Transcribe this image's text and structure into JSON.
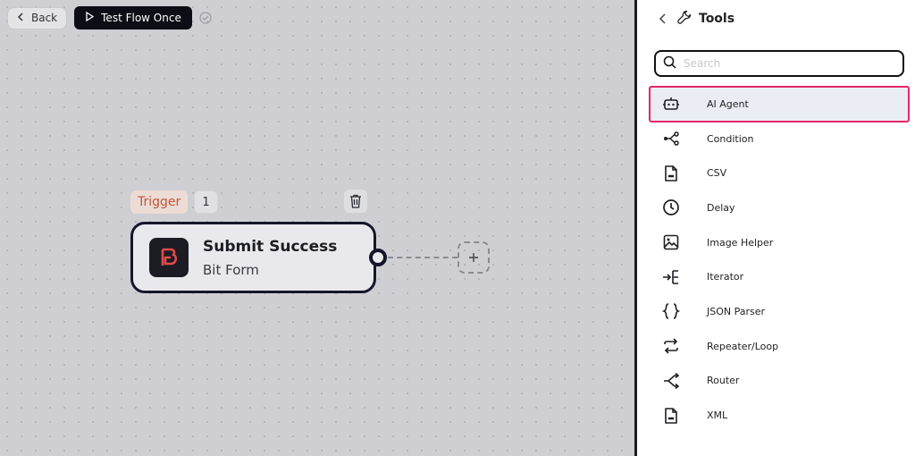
{
  "toolbar": {
    "back_label": "Back",
    "test_label": "Test Flow Once"
  },
  "flow": {
    "trigger_label": "Trigger",
    "node_count": "1",
    "node": {
      "title": "Submit Success",
      "subtitle": "Bit Form"
    }
  },
  "panel": {
    "title": "Tools",
    "search_placeholder": "Search",
    "items": [
      {
        "label": "AI Agent",
        "icon": "robot-icon",
        "active": true
      },
      {
        "label": "Condition",
        "icon": "condition-icon"
      },
      {
        "label": "CSV",
        "icon": "csv-file-icon"
      },
      {
        "label": "Delay",
        "icon": "clock-icon"
      },
      {
        "label": "Image Helper",
        "icon": "image-icon"
      },
      {
        "label": "Iterator",
        "icon": "iterator-icon"
      },
      {
        "label": "JSON Parser",
        "icon": "braces-icon"
      },
      {
        "label": "Repeater/Loop",
        "icon": "repeat-icon"
      },
      {
        "label": "Router",
        "icon": "router-icon"
      },
      {
        "label": "XML",
        "icon": "xml-file-icon"
      }
    ]
  },
  "colors": {
    "highlight_border": "#e5266a",
    "trigger_text": "#c2553a",
    "dark": "#0d0d15"
  }
}
